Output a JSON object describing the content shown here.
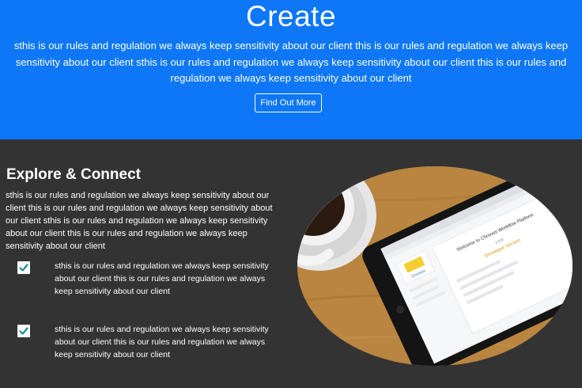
{
  "hero": {
    "title": "Create",
    "text": "sthis is our rules and regulation we always keep sensitivity about our client this is our rules and regulation we always keep sensitivity about our client sthis is our rules and regulation we always keep sensitivity about our client this is our rules and regulation we always keep sensitivity about our client",
    "button_label": "Find Out More",
    "background_color": "#0d77f7"
  },
  "section": {
    "title": "Explore & Connect",
    "text": "sthis is our rules and regulation we always keep sensitivity about our client this is our rules and regulation we always keep sensitivity about our client sthis is our rules and regulation we always keep sensitivity about our client this is our rules and regulation we always keep sensitivity about our client",
    "background_color": "#333333",
    "features": [
      {
        "icon": "check-icon",
        "text": "sthis is our rules and regulation we always keep sensitivity about our client this is our rules and regulation we always keep sensitivity about our client"
      },
      {
        "icon": "check-icon",
        "text": "sthis is our rules and regulation we always keep sensitivity about our client this is our rules and regulation we always keep sensitivity about our client"
      }
    ],
    "image": {
      "screen_text": {
        "logo": "Chronos",
        "welcome": "Welcome to Chronos Workflow Platform",
        "version": "v 4.0",
        "subtitle": "Developer Version"
      }
    }
  }
}
